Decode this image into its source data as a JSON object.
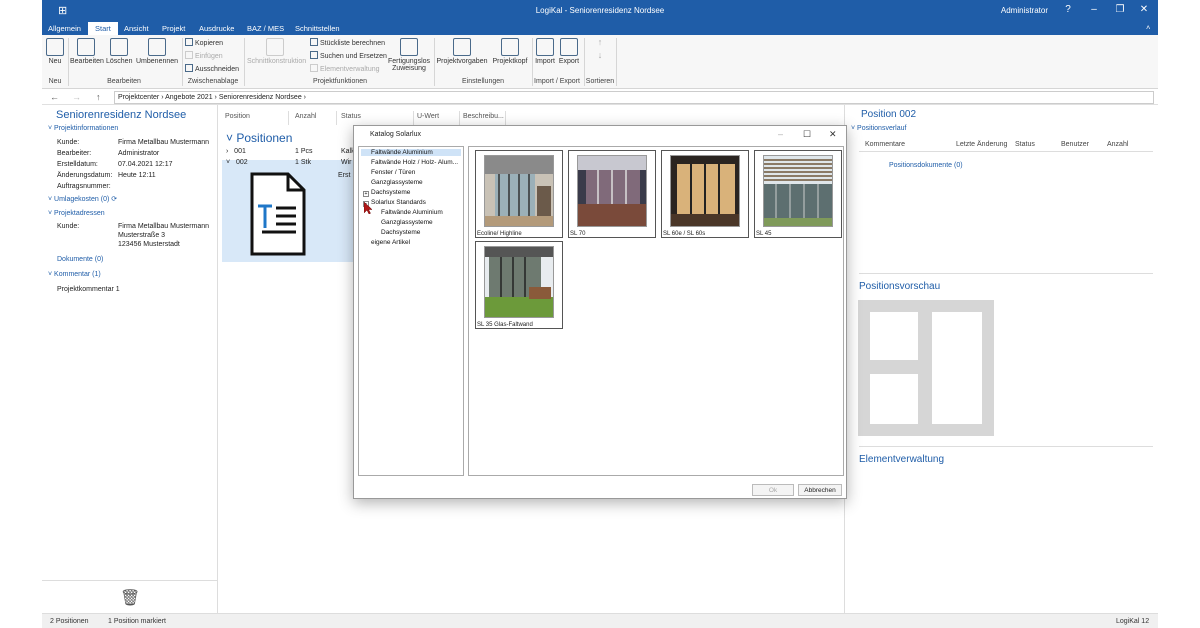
{
  "window": {
    "title": "LogiKal - Seniorenresidenz Nordsee",
    "user": "Administrator",
    "help": "?"
  },
  "menu": {
    "tabs": [
      "Allgemein",
      "Start",
      "Ansicht",
      "Projekt",
      "Ausdrucke",
      "BAZ / MES",
      "Schnittstellen"
    ]
  },
  "ribbon": {
    "neu": "Neu",
    "bearbeiten": "Bearbeiten",
    "loeschen": "Löschen",
    "umbenennen": "Umbenennen",
    "kopieren": "Kopieren",
    "einfuegen": "Einfügen",
    "ausschneiden": "Ausschneiden",
    "schnittkonstruktion": "Schnittkonstruktion",
    "stueckliste": "Stückliste berechnen",
    "suchen": "Suchen und Ersetzen",
    "elementverwaltung": "Elementverwaltung",
    "fertigungslos1": "Fertigungslos",
    "fertigungslos2": "Zuweisung",
    "projektvorgaben": "Projektvorgaben",
    "projektkopf": "Projektkopf",
    "import": "Import",
    "export": "Export",
    "groups": {
      "neu": "Neu",
      "bearbeiten": "Bearbeiten",
      "zwischenablage": "Zwischenablage",
      "projektfunktionen": "Projektfunktionen",
      "einstellungen": "Einstellungen",
      "importexport": "Import / Export",
      "sortieren": "Sortieren"
    }
  },
  "breadcrumb": [
    "Projektcenter",
    "Angebote 2021",
    "Seniorenresidenz Nordsee"
  ],
  "left": {
    "title": "Seniorenresidenz Nordsee",
    "projektinfo": "Projektinformationen",
    "fields": [
      {
        "k": "Kunde:",
        "v": "Firma  Metallbau Mustermann"
      },
      {
        "k": "Bearbeiter:",
        "v": "Administrator"
      },
      {
        "k": "Erstelldatum:",
        "v": "07.04.2021 12:17"
      },
      {
        "k": "Änderungsdatum:",
        "v": "Heute 12:11"
      },
      {
        "k": "Auftragsnummer:",
        "v": ""
      }
    ],
    "umlagekosten": "Umlagekosten (0)",
    "projektadressen": "Projektadressen",
    "adr_k": "Kunde:",
    "adr_lines": [
      "Firma  Metallbau Mustermann",
      "Musterstraße 3",
      "123456 Musterstadt"
    ],
    "dokumente": "Dokumente (0)",
    "kommentar": "Kommentar (1)",
    "kommentar_text": "Projektkommentar 1"
  },
  "mid": {
    "cols": [
      "Position",
      "Anzahl",
      "Status",
      "U-Wert",
      "Beschreibu..."
    ],
    "heading": "Positionen",
    "rows": [
      {
        "pos": "001",
        "anz": "1 Pcs",
        "status": "Kalk"
      },
      {
        "pos": "002",
        "anz": "1 Stk",
        "status": "Wir"
      }
    ],
    "extra": "Erst"
  },
  "right": {
    "title": "Position 002",
    "verlauf": "Positionsverlauf",
    "cols": [
      "Kommentare",
      "Letzte Änderung",
      "Status",
      "Benutzer",
      "Anzahl"
    ],
    "dokumente": "Positionsdokumente (0)",
    "vorschau": "Positionsvorschau",
    "elementverwaltung": "Elementverwaltung"
  },
  "dialog": {
    "title": "Katalog Solarlux",
    "tree": [
      "Faltwände Aluminium",
      "Faltwände Holz / Holz- Alum...",
      "Fenster / Türen",
      "Ganzglassysteme",
      "Dachsysteme",
      "Solarlux Standards",
      "Faltwände Aluminium",
      "Ganzglassysteme",
      "Dachsysteme",
      "eigene Artikel"
    ],
    "tiles": [
      "Ecoline/ Highline",
      "SL 70",
      "SL 60e / SL 60s",
      "SL 45",
      "SL 35 Glas-Faltwand"
    ],
    "ok": "Ok",
    "cancel": "Abbrechen"
  },
  "status": {
    "left1": "2 Positionen",
    "left2": "1 Position markiert",
    "right": "LogiKal 12"
  }
}
